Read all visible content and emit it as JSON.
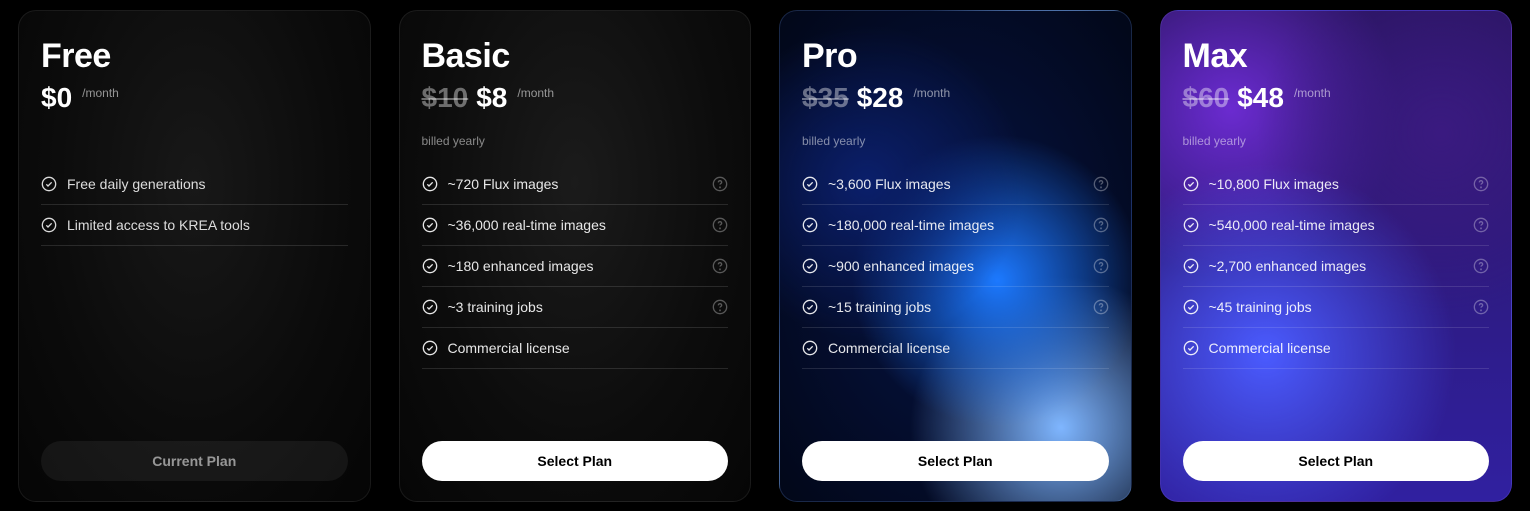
{
  "per_month_label": "/month",
  "plans": [
    {
      "key": "free",
      "name": "Free",
      "old_price": "",
      "price": "$0",
      "billing_note": "",
      "cta_label": "Current Plan",
      "cta_kind": "current",
      "features": [
        {
          "text": "Free daily generations",
          "help": false
        },
        {
          "text": "Limited access to KREA tools",
          "help": false
        }
      ]
    },
    {
      "key": "basic",
      "name": "Basic",
      "old_price": "$10",
      "price": "$8",
      "billing_note": "billed yearly",
      "cta_label": "Select Plan",
      "cta_kind": "primary",
      "features": [
        {
          "text": "~720 Flux images",
          "help": true
        },
        {
          "text": "~36,000 real-time images",
          "help": true
        },
        {
          "text": "~180 enhanced images",
          "help": true
        },
        {
          "text": "~3 training jobs",
          "help": true
        },
        {
          "text": "Commercial license",
          "help": false
        }
      ]
    },
    {
      "key": "pro",
      "name": "Pro",
      "old_price": "$35",
      "price": "$28",
      "billing_note": "billed yearly",
      "cta_label": "Select Plan",
      "cta_kind": "primary",
      "features": [
        {
          "text": "~3,600 Flux images",
          "help": true
        },
        {
          "text": "~180,000 real-time images",
          "help": true
        },
        {
          "text": "~900 enhanced images",
          "help": true
        },
        {
          "text": "~15 training jobs",
          "help": true
        },
        {
          "text": "Commercial license",
          "help": false
        }
      ]
    },
    {
      "key": "max",
      "name": "Max",
      "old_price": "$60",
      "price": "$48",
      "billing_note": "billed yearly",
      "cta_label": "Select Plan",
      "cta_kind": "primary",
      "features": [
        {
          "text": "~10,800 Flux images",
          "help": true
        },
        {
          "text": "~540,000 real-time images",
          "help": true
        },
        {
          "text": "~2,700 enhanced images",
          "help": true
        },
        {
          "text": "~45 training jobs",
          "help": true
        },
        {
          "text": "Commercial license",
          "help": false
        }
      ]
    }
  ]
}
